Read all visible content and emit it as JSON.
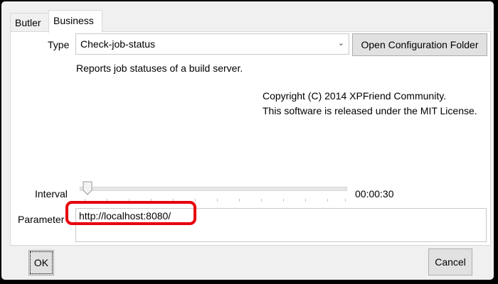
{
  "tabs": [
    {
      "label": "Butler"
    },
    {
      "label": "Business"
    }
  ],
  "form": {
    "type_label": "Type",
    "type_value": "Check-job-status",
    "open_folder_label": "Open Configuration Folder",
    "description": "Reports job statuses of a build server.",
    "copyright_line1": "Copyright (C) 2014 XPFriend Community.",
    "copyright_line2": "This software is released under the MIT License.",
    "interval_label": "Interval",
    "interval_value": "00:00:30",
    "interval_slider_fraction": 0.04,
    "parameter_label": "Parameter",
    "parameter_value": "http://localhost:8080/"
  },
  "buttons": {
    "ok_label": "OK",
    "cancel_label": "Cancel"
  },
  "colors": {
    "highlight": "#e8000d",
    "window_bg": "#f0f0f0",
    "panel_bg": "#ffffff"
  },
  "icons": {
    "combo_arrow": "chevron-down-icon",
    "slider_thumb": "slider-thumb-icon"
  }
}
